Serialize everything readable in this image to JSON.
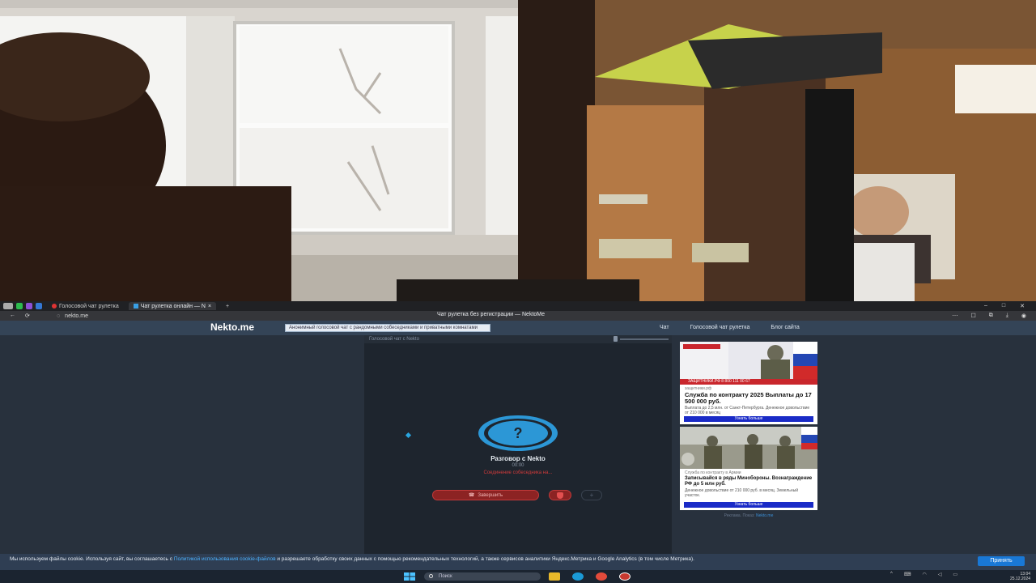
{
  "browser": {
    "tabs": [
      {
        "label": "Голосовой чат рулетка"
      },
      {
        "label": "Чат рулетка онлайн — N"
      }
    ],
    "url": "nekto.me",
    "page_title": "Чат рулетка без регистрации — NektoMe",
    "icons": [
      "back-icon",
      "reload-icon",
      "new-tab-icon",
      "minimize-icon",
      "maximize-icon",
      "close-icon"
    ]
  },
  "site": {
    "logo": "Nekto.me",
    "promo_text": "Анонимный голосовой чат с рандомными собеседниками и приватными комнатами",
    "nav": [
      "Чат",
      "Голосовой чат рулетка",
      "Блог сайта"
    ]
  },
  "chat": {
    "header": "Голосовой чат с Nekto",
    "title": "Разговор с Nekto",
    "subtitle": "00:00",
    "warning": "Соединение собеседника на...",
    "end_button": "Завершить"
  },
  "ads": [
    {
      "strip": "ЗАЩИТНИКИ.РФ  8 800 111 00 67",
      "source": "защитники.рф",
      "title": "Служба по контракту 2025 Выплаты до 17 500 000 руб.",
      "desc": "Выплата до 2,5 млн. от Санкт-Петербурга. Денежное довольствие от 210 000 в месяц",
      "cta": "Узнать больше"
    },
    {
      "strip": "",
      "source": "Служба по контракту в Армии",
      "title": "Записывайся в ряды Минобороны. Вознаграждение РФ до 5 млн руб.",
      "desc": "Денежное довольствие от 210 000 руб. в месяц. Земельный участок.",
      "cta": "Узнать больше"
    }
  ],
  "ad_footer_prefix": "Реклама. Показ:",
  "ad_footer_link": "Nekto.me",
  "cookie": {
    "text_before": "Мы используем файлы cookie. Используя сайт, вы соглашаетесь с ",
    "link": "Политикой использования cookie-файлов",
    "text_after": " и разрешаете обработку своих данных с помощью рекомендательных технологий, а также сервисов аналитики Яндекс.Метрика и Google Analytics (в том числе Метрика).",
    "button": "Принять"
  },
  "taskbar": {
    "search_placeholder": "Поиск",
    "time": "13:04",
    "date": "25.12.2024"
  }
}
